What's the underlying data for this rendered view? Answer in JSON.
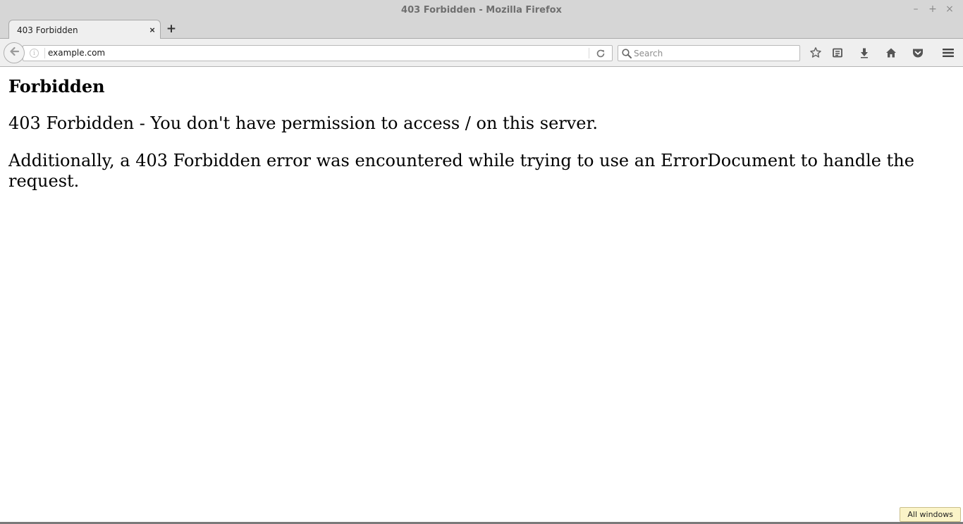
{
  "window": {
    "title": "403 Forbidden - Mozilla Firefox",
    "minimize": "–",
    "maximize": "+",
    "close": "×"
  },
  "tabs": [
    {
      "label": "403 Forbidden",
      "close": "×"
    }
  ],
  "new_tab": "+",
  "navbar": {
    "url": "example.com",
    "info": "i",
    "search_placeholder": "Search"
  },
  "page": {
    "heading": "Forbidden",
    "paragraph_1": "403 Forbidden - You don't have permission to access / on this server.",
    "paragraph_2": "Additionally, a 403 Forbidden error was encountered while trying to use an ErrorDocument to handle the request."
  },
  "status": {
    "all_windows": "All windows"
  },
  "colors": {
    "chrome_bg": "#d6d6d6",
    "toolbar_bg": "#efefef",
    "icon": "#555555"
  },
  "icons": [
    "back-arrow-icon",
    "info-icon",
    "reload-icon",
    "search-icon",
    "bookmark-star-icon",
    "reading-list-icon",
    "download-icon",
    "home-icon",
    "pocket-icon",
    "hamburger-menu-icon"
  ]
}
